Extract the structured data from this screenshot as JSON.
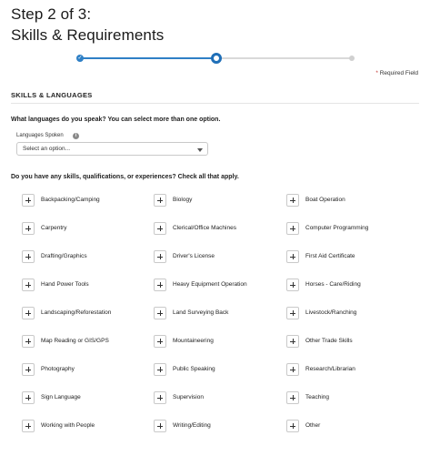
{
  "header": {
    "step": "Step 2 of 3:",
    "title": "Skills & Requirements"
  },
  "stepper": {
    "current_step": 2,
    "total_steps": 3
  },
  "required_note": {
    "asterisk": "*",
    "text": "Required Field"
  },
  "section": {
    "title": "SKILLS & LANGUAGES"
  },
  "languages": {
    "question": "What languages do you speak? You can select more than one option.",
    "label": "Languages Spoken",
    "info_icon": "info-icon",
    "placeholder": "Select an option..."
  },
  "skills": {
    "question": "Do you have any skills, qualifications, or experiences? Check all that apply.",
    "options": [
      "Backpacking/Camping",
      "Biology",
      "Boat Operation",
      "Carpentry",
      "Clerical/Office Machines",
      "Computer Programming",
      "Drafting/Graphics",
      "Driver's License",
      "First Aid Certificate",
      "Hand Power Tools",
      "Heavy Equipment Operation",
      "Horses - Care/Riding",
      "Landscaping/Reforestation",
      "Land Surveying Back",
      "Livestock/Ranching",
      "Map Reading or GIS/GPS",
      "Mountaineering",
      "Other Trade Skills",
      "Photography",
      "Public Speaking",
      "Research/Librarian",
      "Sign Language",
      "Supervision",
      "Teaching",
      "Working with People",
      "Writing/Editing",
      "Other"
    ]
  }
}
